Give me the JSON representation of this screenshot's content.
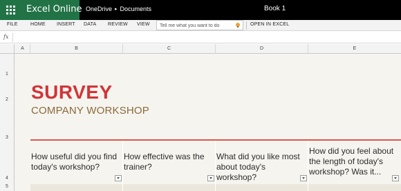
{
  "app": {
    "name": "Excel Online",
    "breadcrumb": [
      "OneDrive",
      "Documents"
    ],
    "document_title": "Book 1",
    "brand_color": "#217346"
  },
  "ribbon": {
    "tabs": [
      "FILE",
      "HOME",
      "INSERT",
      "DATA",
      "REVIEW",
      "VIEW"
    ],
    "tell_me_placeholder": "Tell me what you want to do",
    "open_in_excel": "OPEN IN EXCEL"
  },
  "formula_bar": {
    "fx_label": "fx",
    "value": ""
  },
  "grid": {
    "columns": [
      "A",
      "B",
      "C",
      "D",
      "E"
    ],
    "rows": [
      "1",
      "2",
      "3",
      "4",
      "5"
    ]
  },
  "survey": {
    "title": "SURVEY",
    "subtitle": "COMPANY WORKSHOP",
    "title_color": "#d13438",
    "subtitle_color": "#8a6a3a",
    "questions": [
      "How useful did you find today's workshop?",
      "How effective was the trainer?",
      "What did you like most about today's workshop?",
      "How did you feel about the length of today's workshop? Was it..."
    ]
  }
}
